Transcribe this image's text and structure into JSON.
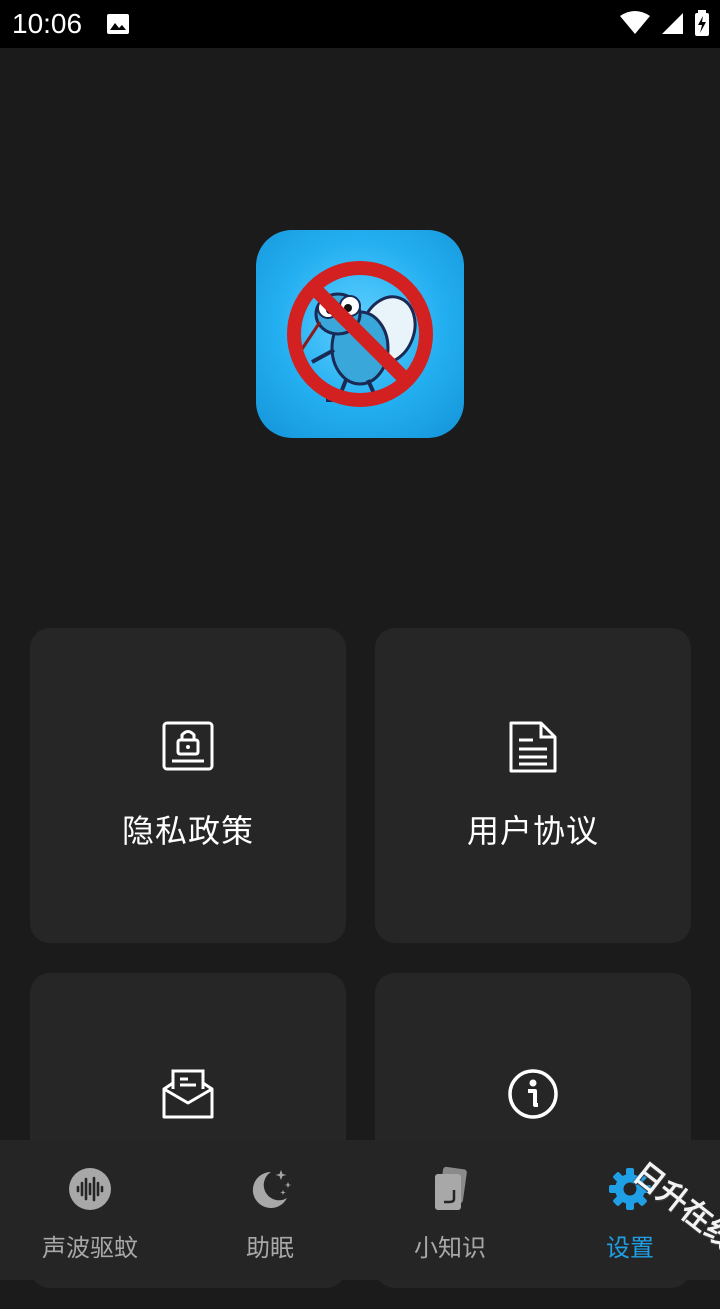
{
  "status_bar": {
    "time": "10:06"
  },
  "cards": [
    {
      "label": "隐私政策",
      "icon": "privacy-lock-document-icon"
    },
    {
      "label": "用户协议",
      "icon": "document-lines-icon"
    },
    {
      "label": "",
      "icon": "envelope-message-icon"
    },
    {
      "label": "",
      "icon": "info-circle-icon"
    }
  ],
  "bottom_nav": [
    {
      "label": "声波驱蚊",
      "icon": "sound-wave-icon",
      "active": false
    },
    {
      "label": "助眠",
      "icon": "moon-stars-icon",
      "active": false
    },
    {
      "label": "小知识",
      "icon": "cards-icon",
      "active": false
    },
    {
      "label": "设置",
      "icon": "gear-icon",
      "active": true
    }
  ],
  "watermark": "日升在线",
  "colors": {
    "background": "#1b1b1b",
    "card": "#262626",
    "nav_bg": "#252525",
    "active": "#1fa0e6",
    "inactive": "#a8a8a8"
  }
}
